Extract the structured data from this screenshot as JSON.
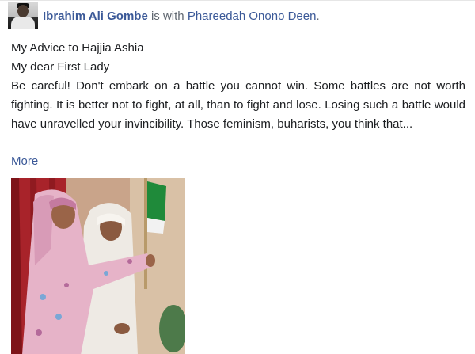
{
  "post": {
    "author": "Ibrahim Ali Gombe",
    "with_text": "is with",
    "tagged_person": "Phareedah Onono Deen",
    "tagged_suffix": ".",
    "line1": "My Advice to Hajjia Ashia",
    "line2": "My dear First Lady",
    "body": "Be careful! Don't embark on a battle you cannot win. Some battles are not worth fighting. It is better not to fight, at all, than to fight and lose. Losing such a battle would have unravelled your invincibility. Those feminism, buharists, you think that...",
    "more_label": "More"
  },
  "icons": {
    "avatar": "profile-photo-man-in-cap",
    "photo": "two-women-embracing-photo"
  },
  "colors": {
    "link": "#3b5998",
    "text": "#1c1e21",
    "muted": "#606770"
  }
}
